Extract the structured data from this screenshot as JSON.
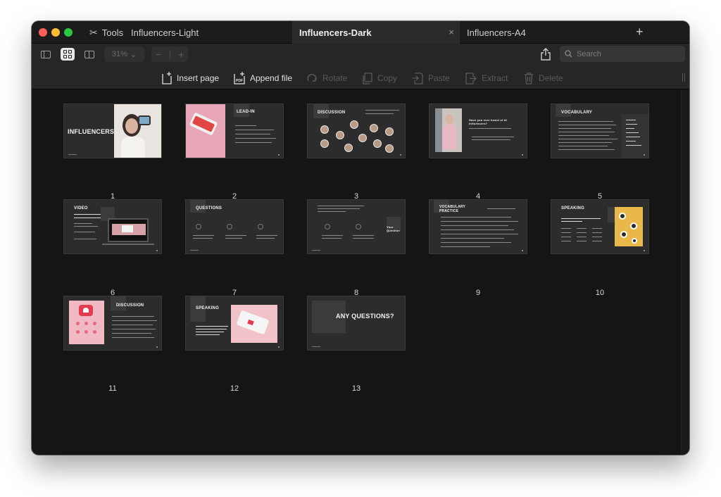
{
  "window": {
    "tools_label": "Tools",
    "tabs": [
      {
        "label": "Influencers-Light",
        "active": false
      },
      {
        "label": "Influencers-Dark",
        "active": true
      },
      {
        "label": "Influencers-A4",
        "active": false
      }
    ],
    "new_tab": "+",
    "close_tab": "×"
  },
  "toolbar": {
    "zoom": "31%",
    "zoom_chevron": "⌄",
    "minus": "−",
    "plus": "+",
    "search_placeholder": "Search"
  },
  "actions": [
    {
      "label": "Insert page",
      "enabled": true
    },
    {
      "label": "Append file",
      "enabled": true
    },
    {
      "label": "Rotate",
      "enabled": false
    },
    {
      "label": "Copy",
      "enabled": false
    },
    {
      "label": "Paste",
      "enabled": false
    },
    {
      "label": "Extract",
      "enabled": false
    },
    {
      "label": "Delete",
      "enabled": false
    }
  ],
  "pages": [
    {
      "number": "1",
      "title": "INFLUENCERS"
    },
    {
      "number": "2",
      "title": "LEAD-IN"
    },
    {
      "number": "3",
      "title": "DISCUSSION"
    },
    {
      "number": "4",
      "title": "Have you ever heard of AI influencers?"
    },
    {
      "number": "5",
      "title": "VOCABULARY"
    },
    {
      "number": "6",
      "title": "VIDEO"
    },
    {
      "number": "7",
      "title": "QUESTIONS"
    },
    {
      "number": "8",
      "title": "Your Question"
    },
    {
      "number": "9",
      "title": "VOCABULARY PRACTICE"
    },
    {
      "number": "10",
      "title": "SPEAKING"
    },
    {
      "number": "11",
      "title": "DISCUSSION"
    },
    {
      "number": "12",
      "title": "SPEAKING"
    },
    {
      "number": "13",
      "title": "ANY QUESTIONS?"
    }
  ],
  "colors": {
    "window_bg": "#141414",
    "active_tab": "#2b2b2b",
    "accent_pink": "#e8a7b9",
    "disabled_text": "#5a5a5a"
  }
}
